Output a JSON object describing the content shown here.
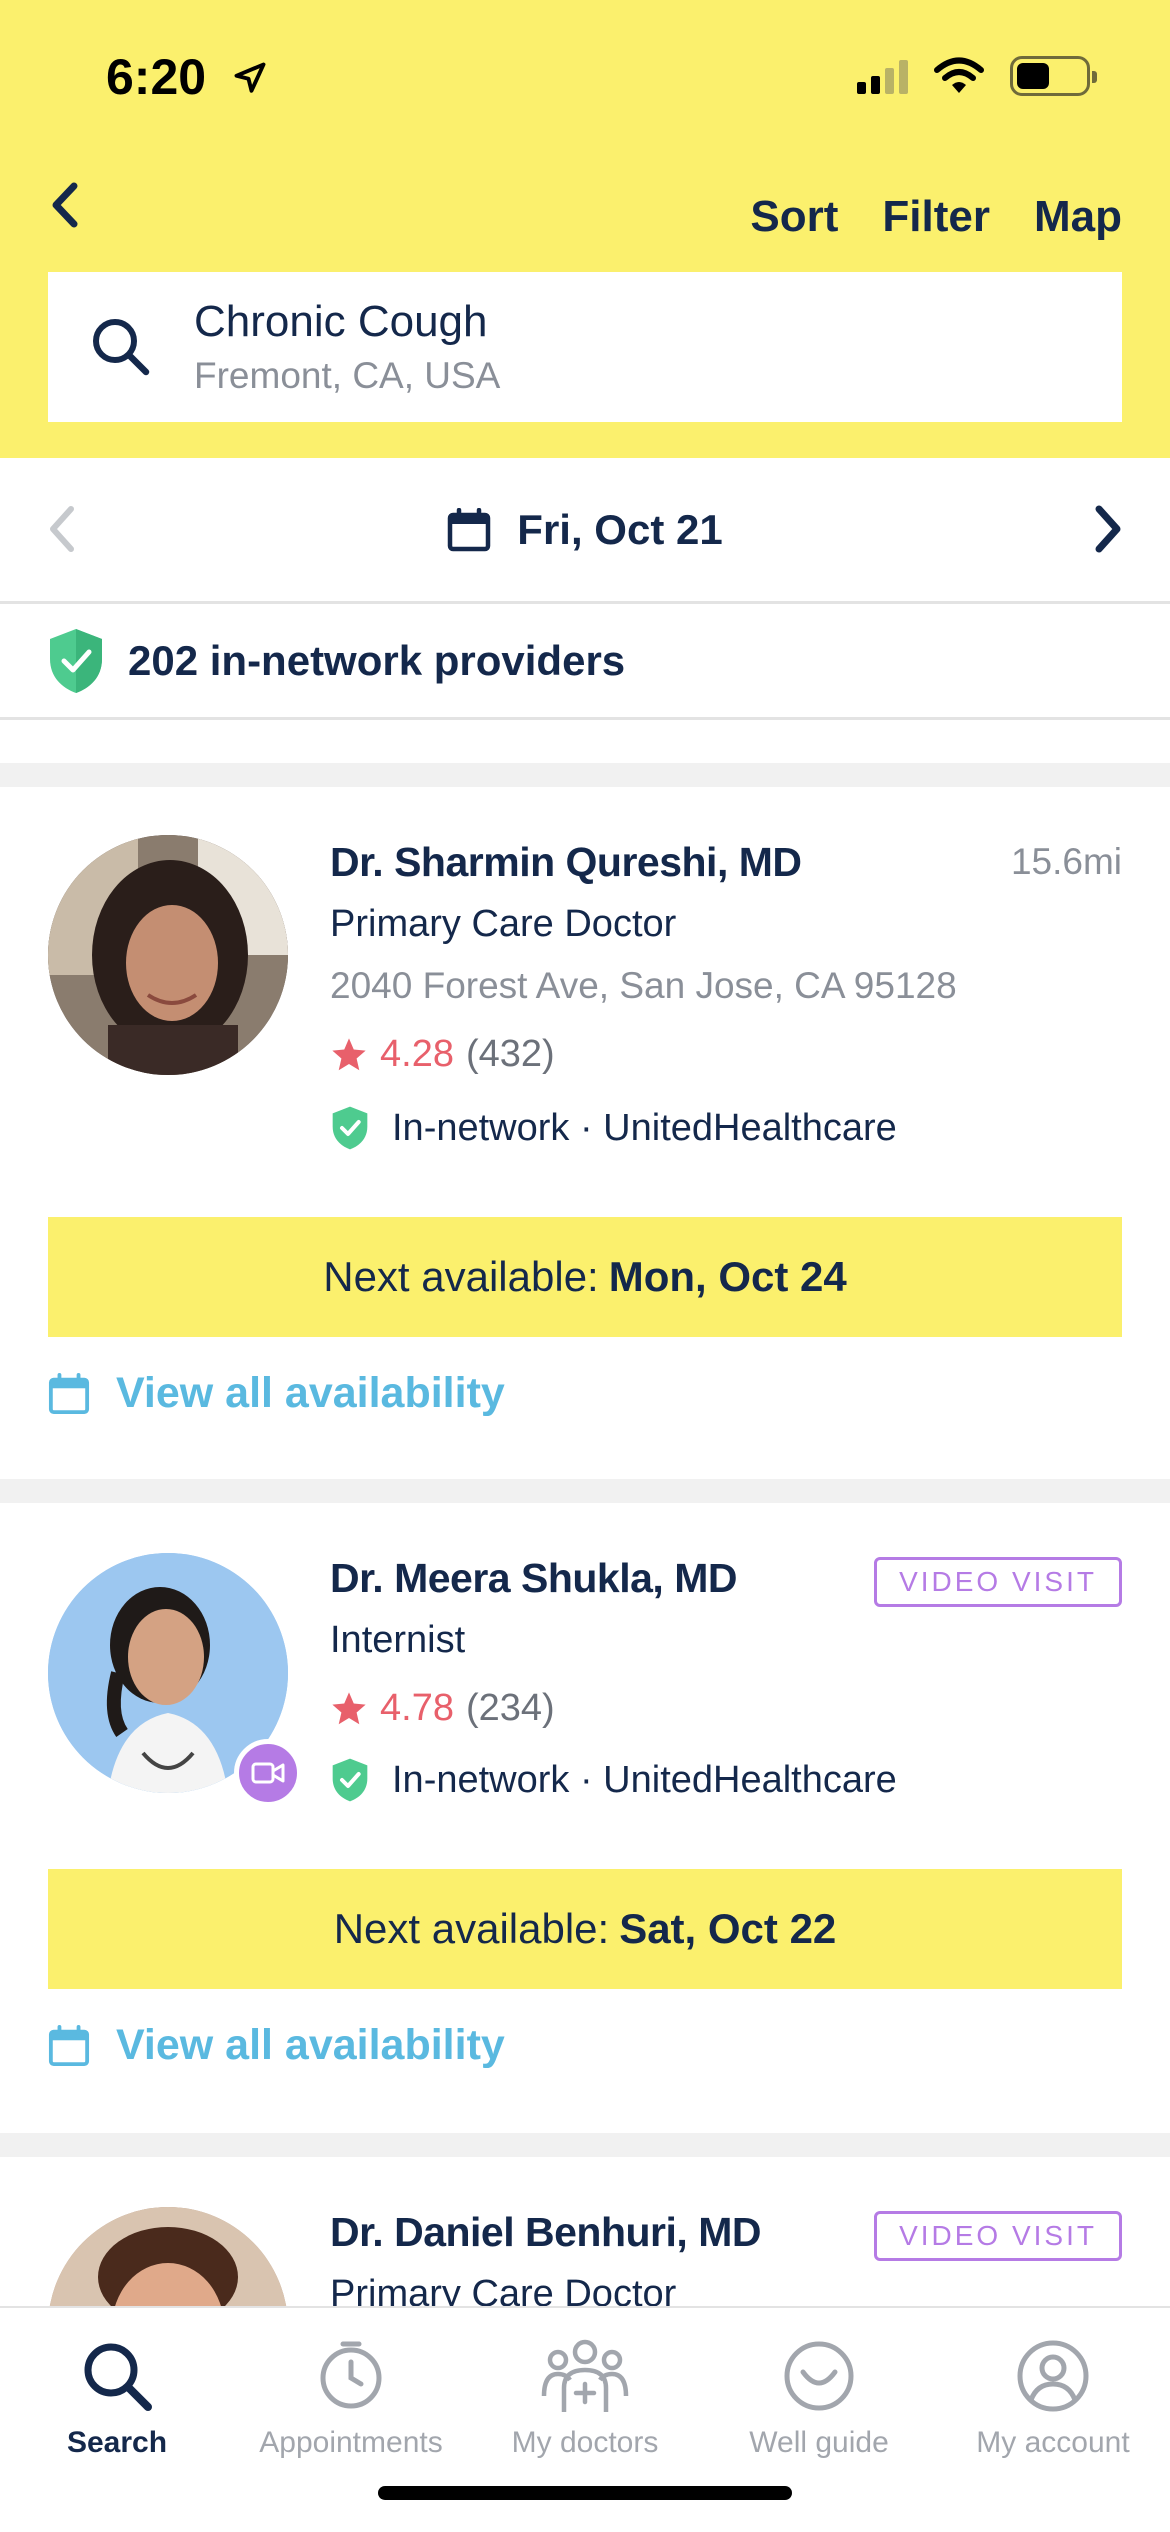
{
  "status_bar": {
    "time": "6:20"
  },
  "header": {
    "actions": {
      "sort": "Sort",
      "filter": "Filter",
      "map": "Map"
    },
    "search": {
      "query": "Chronic Cough",
      "location": "Fremont, CA, USA"
    }
  },
  "date_nav": {
    "date": "Fri, Oct 21"
  },
  "network_summary": {
    "text": "202 in-network providers"
  },
  "providers": [
    {
      "name": "Dr. Sharmin Qureshi, MD",
      "distance": "15.6mi",
      "specialty": "Primary Care Doctor",
      "address": "2040 Forest Ave, San Jose, CA 95128",
      "rating": "4.28",
      "review_count": "(432)",
      "network": "In-network · UnitedHealthcare",
      "next_label": "Next available:",
      "next_date": "Mon, Oct 24",
      "view_all": "View all availability"
    },
    {
      "name": "Dr. Meera Shukla, MD",
      "tag": "VIDEO VISIT",
      "specialty": "Internist",
      "rating": "4.78",
      "review_count": "(234)",
      "network": "In-network · UnitedHealthcare",
      "next_label": "Next available:",
      "next_date": "Sat, Oct 22",
      "view_all": "View all availability"
    },
    {
      "name": "Dr. Daniel Benhuri, MD",
      "tag": "VIDEO VISIT",
      "specialty": "Primary Care Doctor"
    }
  ],
  "tabs": [
    {
      "label": "Search",
      "icon": "search-icon",
      "active": true
    },
    {
      "label": "Appointments",
      "icon": "clock-icon"
    },
    {
      "label": "My doctors",
      "icon": "doctors-icon"
    },
    {
      "label": "Well guide",
      "icon": "smile-icon"
    },
    {
      "label": "My account",
      "icon": "account-icon"
    }
  ],
  "colors": {
    "brand_yellow": "#fbf06d",
    "navy": "#14284b",
    "link_blue": "#5ab9e0",
    "rating_red": "#e8606b",
    "network_green": "#4ecb8f",
    "video_purple": "#b57be5"
  }
}
